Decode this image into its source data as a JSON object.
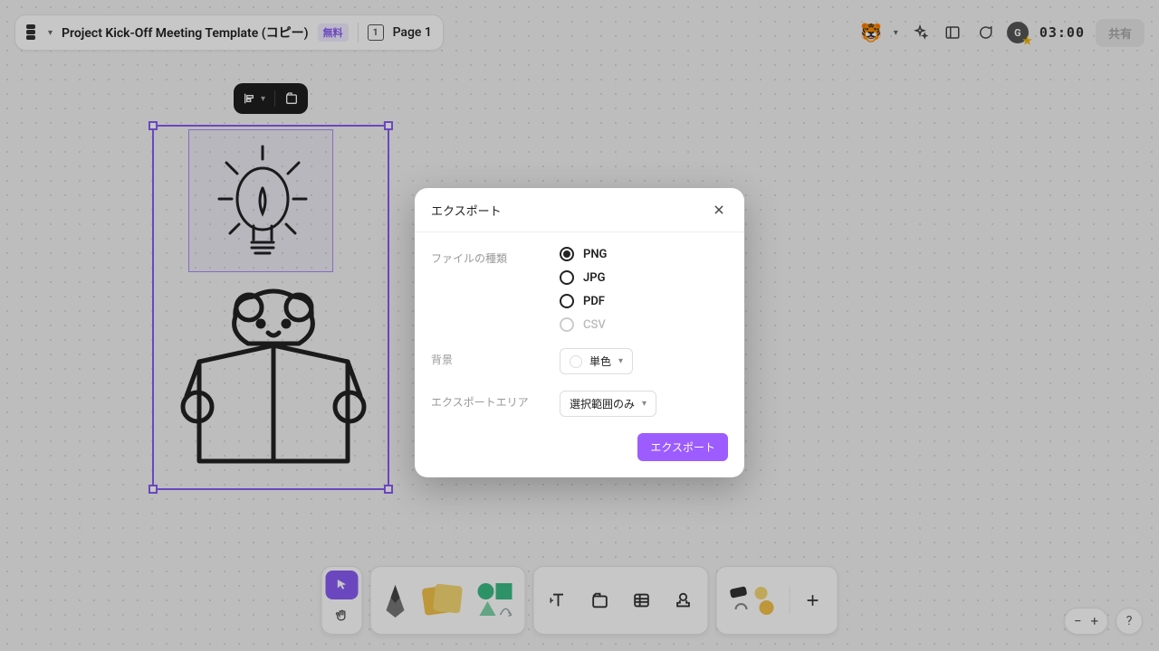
{
  "header": {
    "project_title": "Project Kick-Off Meeting Template (コピー)",
    "free_badge": "無料",
    "page_label": "Page 1",
    "page_number": "1",
    "timer": "03:00",
    "share_label": "共有"
  },
  "dialog": {
    "title": "エクスポート",
    "file_type_label": "ファイルの種類",
    "options": {
      "png": "PNG",
      "jpg": "JPG",
      "pdf": "PDF",
      "csv": "CSV"
    },
    "selected": "png",
    "background_label": "背景",
    "background_value": "単色",
    "area_label": "エクスポートエリア",
    "area_value": "選択範囲のみ",
    "export_button": "エクスポート"
  },
  "zoom": {
    "minus": "−",
    "plus": "+",
    "help": "?"
  },
  "icons": {
    "avatar_emoji": "🐯",
    "avatar_letter": "G"
  }
}
